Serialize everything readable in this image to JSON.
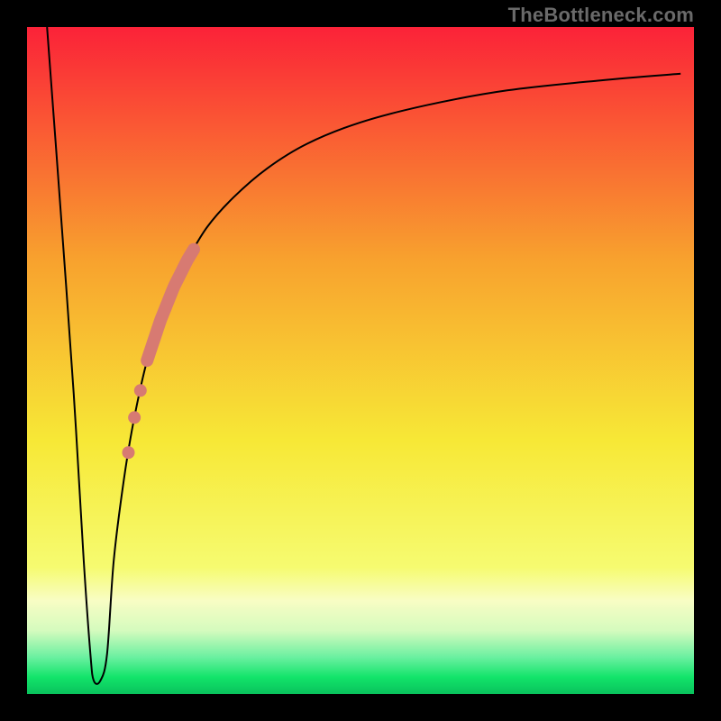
{
  "watermark": "TheBottleneck.com",
  "chart_data": {
    "type": "line",
    "title": "",
    "xlabel": "",
    "ylabel": "",
    "xlim": [
      0,
      100
    ],
    "ylim": [
      0,
      100
    ],
    "grid": false,
    "legend": "none",
    "background_gradient": {
      "top": "#fb2238",
      "mid_upper": "#f8a22e",
      "mid": "#f7e836",
      "mid_lower": "#f6fb70",
      "green": "#12e46a",
      "bottom_accent": "#09c25c"
    },
    "series": [
      {
        "name": "bottleneck-curve",
        "x": [
          3,
          5,
          7,
          8.5,
          9.5,
          10,
          11,
          12,
          13,
          14.5,
          16,
          18,
          20,
          22,
          24,
          27,
          31,
          36,
          42,
          50,
          60,
          72,
          86,
          98
        ],
        "y": [
          100,
          73,
          45,
          20,
          6,
          2,
          2,
          6,
          20,
          32,
          41,
          50,
          56,
          61,
          65,
          70,
          74.5,
          78.8,
          82.5,
          85.7,
          88.3,
          90.5,
          92,
          93
        ],
        "stroke": "#000000",
        "stroke_width": 2
      }
    ],
    "highlight_band": {
      "name": "salmon-bar",
      "along_curve_x": [
        18.0,
        25.0
      ],
      "color": "#d77a72",
      "width": 14
    },
    "highlight_dots": {
      "name": "salmon-dots",
      "points_x": [
        17.0,
        16.1,
        15.2
      ],
      "color": "#d77a72",
      "radius": 7
    }
  }
}
